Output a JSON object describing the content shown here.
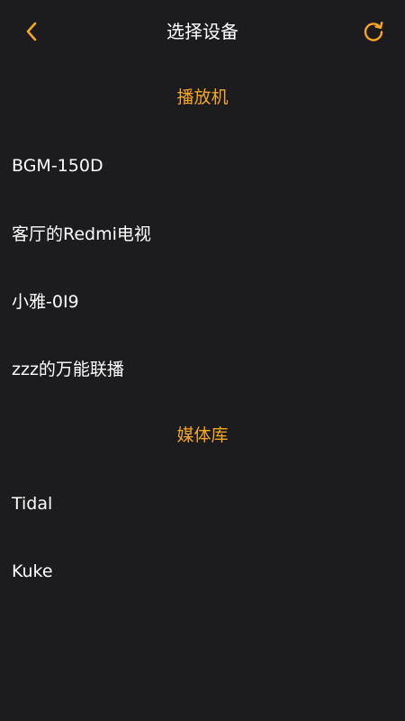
{
  "colors": {
    "background": "#1c1c1e",
    "accent": "#f5a623",
    "text": "#ffffff"
  },
  "header": {
    "title": "选择设备",
    "back_icon": "chevron-left-icon",
    "refresh_icon": "refresh-icon"
  },
  "sections": [
    {
      "title": "播放机",
      "items": [
        "BGM-150D",
        "客厅的Redmi电视",
        "小雅-0I9",
        "zzz的万能联播"
      ]
    },
    {
      "title": "媒体库",
      "items": [
        "Tidal",
        "Kuke"
      ]
    }
  ]
}
